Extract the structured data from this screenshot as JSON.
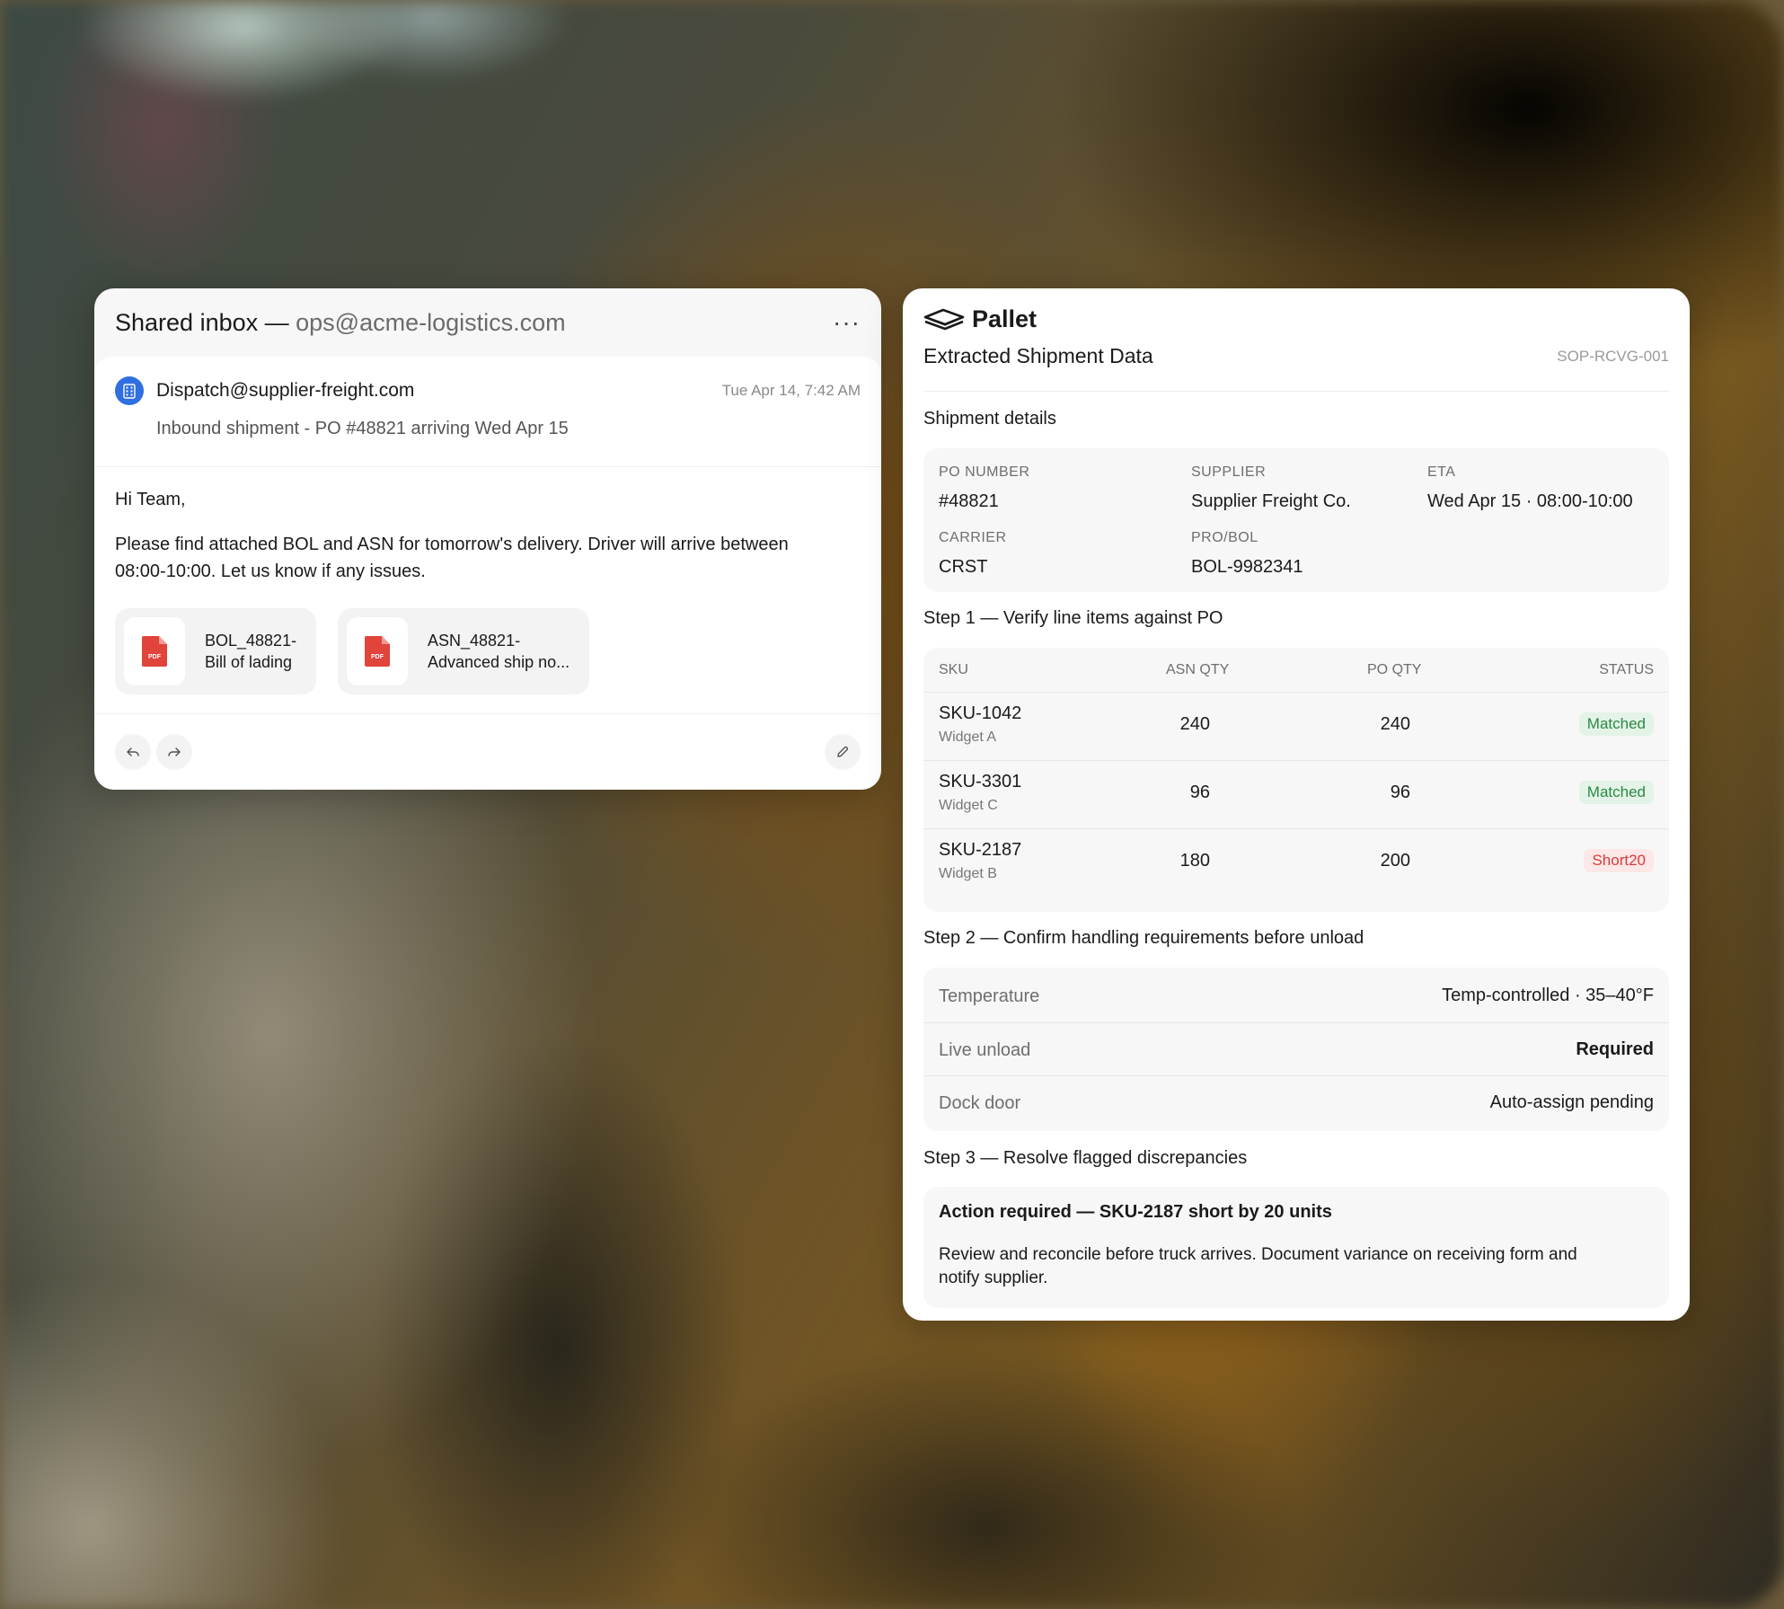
{
  "email": {
    "title_prefix": "Shared inbox — ",
    "title_address": "ops@acme-logistics.com",
    "more_label": "···",
    "sender": "Dispatch@supplier-freight.com",
    "date": "Tue Apr 14, 7:42 AM",
    "subject": "Inbound shipment - PO #48821 arriving Wed Apr 15",
    "greeting": "Hi Team,",
    "message": "Please find attached BOL and ASN for tomorrow's delivery. Driver will arrive between 08:00-10:00. Let us know if any issues.",
    "attachments": [
      {
        "line1": "BOL_48821-",
        "line2": "Bill of lading",
        "type": "PDF"
      },
      {
        "line1": "ASN_48821-",
        "line2": "Advanced ship no...",
        "type": "PDF"
      }
    ]
  },
  "panel": {
    "brand": "Pallet",
    "title": "Extracted Shipment Data",
    "code": "SOP-RCVG-001",
    "shipment": {
      "section_title": "Shipment details",
      "po_label": "PO NUMBER",
      "po_value": "#48821",
      "supplier_label": "SUPPLIER",
      "supplier_value": "Supplier Freight Co.",
      "eta_label": "ETA",
      "eta_value": "Wed Apr 15 · 08:00-10:00",
      "carrier_label": "CARRIER",
      "carrier_value": "CRST",
      "probol_label": "PRO/BOL",
      "probol_value": "BOL-9982341"
    },
    "step1": {
      "title": "Step 1 — Verify line items against PO",
      "headers": {
        "sku": "SKU",
        "asn": "ASN QTY",
        "po": "PO QTY",
        "status": "STATUS"
      },
      "rows": [
        {
          "sku": "SKU-1042",
          "name": "Widget A",
          "asn": "240",
          "po": "240",
          "status": "Matched"
        },
        {
          "sku": "SKU-3301",
          "name": "Widget C",
          "asn": "96",
          "po": "96",
          "status": "Matched"
        },
        {
          "sku": "SKU-2187",
          "name": "Widget B",
          "asn": "180",
          "po": "200",
          "status": "Short20"
        }
      ]
    },
    "step2": {
      "title": "Step 2 — Confirm handling requirements before unload",
      "rows": [
        {
          "label": "Temperature",
          "value": "Temp-controlled · 35–40°F"
        },
        {
          "label": "Live unload",
          "value": "Required"
        },
        {
          "label": "Dock door",
          "value": "Auto-assign pending"
        }
      ]
    },
    "step3": {
      "title": "Step 3 — Resolve flagged discrepancies",
      "action_title": "Action required — SKU-2187 short by 20 units",
      "action_text": "Review and reconcile before truck arrives. Document variance on receiving form and notify supplier."
    }
  },
  "colors": {
    "matched_bg": "#e4f3e7",
    "matched_fg": "#2a8a45",
    "short_bg": "#fde7e7",
    "short_fg": "#d83a3a",
    "avatar": "#2f6fe0",
    "pdf": "#e0443a"
  },
  "icons": [
    "building-icon",
    "pdf-icon",
    "reply-icon",
    "forward-icon",
    "edit-icon",
    "pallet-logo-icon",
    "more-icon"
  ]
}
